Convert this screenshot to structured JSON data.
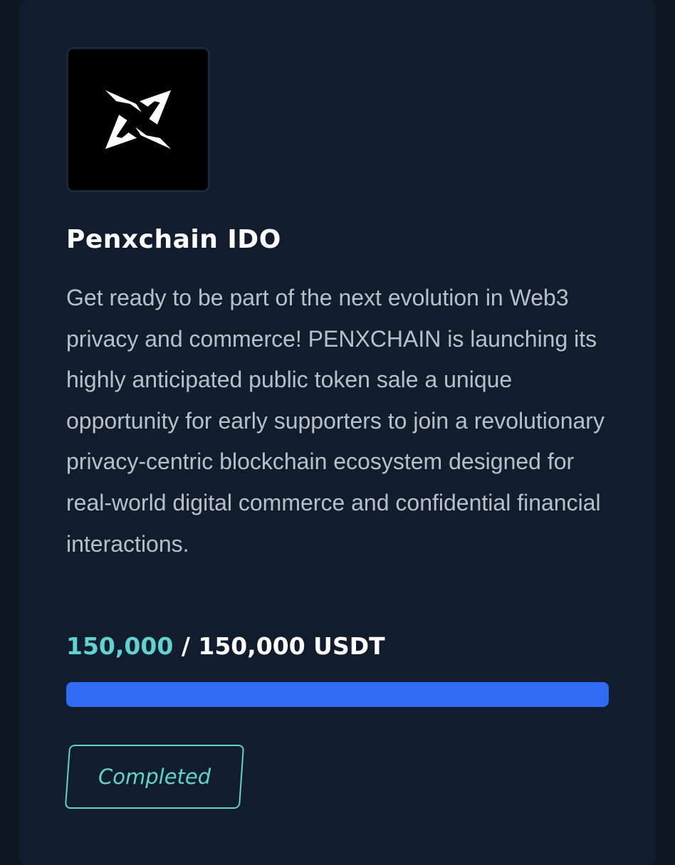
{
  "colors": {
    "page_bg": "#0b1620",
    "card_bg": "#111d2d",
    "accent_teal": "#5ed3cf",
    "progress_blue": "#2f6bf0",
    "description_text": "#b7c0ca",
    "title_text": "#ffffff"
  },
  "project": {
    "logo_icon": "penxchain-x-logo-icon",
    "title": "Penxchain IDO",
    "description": "Get ready to be part of the next evolution in Web3 privacy and commerce! PENXCHAIN is launching its highly anticipated public token sale a unique opportunity for early supporters to join a revolutionary privacy-centric blockchain ecosystem designed for real-world digital commerce and confidential financial interactions."
  },
  "raise": {
    "raised": "150,000",
    "separator": "/",
    "goal": "150,000 USDT",
    "progress_percent": 100
  },
  "status": {
    "label": "Completed"
  }
}
